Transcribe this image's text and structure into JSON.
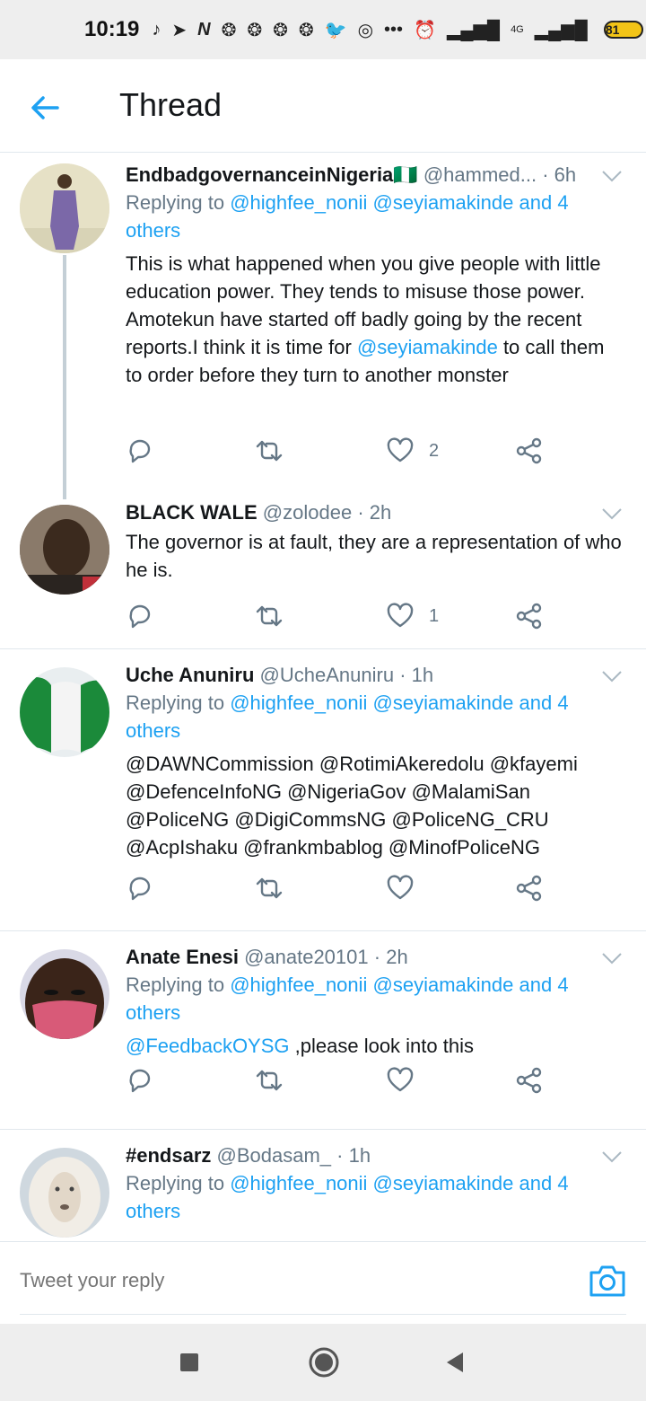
{
  "status_bar": {
    "time": "10:19",
    "icons": [
      "tiktok-icon",
      "telegram-icon",
      "nairaland-icon",
      "app-icon",
      "app-icon",
      "app-icon",
      "app-icon",
      "twitter-icon",
      "instagram-icon",
      "more-icon",
      "alarm-off-icon",
      "signal-icon",
      "4g-signal-icon"
    ],
    "network": "4G",
    "battery": "81"
  },
  "header": {
    "title": "Thread"
  },
  "tweets": [
    {
      "name": "EndbadgovernanceinNigeria",
      "flag": "🇳🇬",
      "handle": "@hammed...",
      "time": "· 6h",
      "replying_prefix": "Replying to",
      "replying_to": "@highfee_nonii @seyiamakinde and 4",
      "replying_suffix": "others",
      "body_part1": "This is what happened when you give people with little education power. They tends to misuse those power. Amotekun have started off badly going by the recent reports.I think it is time for ",
      "body_mention": "@seyiamakinde",
      "body_part2": " to call them to order before they turn to another monster",
      "likes": "2"
    },
    {
      "name": "BLACK WALE",
      "handle": "@zolodee",
      "time": "· 2h",
      "body": "The governor is at fault, they are a representation of who he is.",
      "likes": "1"
    },
    {
      "name": "Uche Anuniru",
      "handle": "@UcheAnuniru",
      "time": "· 1h",
      "replying_prefix": "Replying to",
      "replying_to": "@highfee_nonii @seyiamakinde and 4",
      "replying_suffix": "others",
      "body": "@DAWNCommission @RotimiAkeredolu @kfayemi @DefenceInfoNG @NigeriaGov @MalamiSan @PoliceNG @DigiCommsNG @PoliceNG_CRU @AcpIshaku @frankmbablog @MinofPoliceNG"
    },
    {
      "name": "Anate Enesi",
      "handle": "@anate20101",
      "time": "· 2h",
      "replying_prefix": "Replying to",
      "replying_to": "@highfee_nonii @seyiamakinde and 4",
      "replying_suffix": "others",
      "body_mention": "@FeedbackOYSG",
      "body_text": " ,please look into this"
    },
    {
      "name": "#endsarz",
      "handle": "@Bodasam_",
      "time": "· 1h",
      "replying_prefix": "Replying to",
      "replying_to": "@highfee_nonii @seyiamakinde and 4",
      "replying_suffix": "others"
    }
  ],
  "reply_bar": {
    "placeholder": "Tweet your reply"
  },
  "colors": {
    "accent": "#1da1f2",
    "text": "#14171a",
    "muted": "#657786",
    "divider": "#e1e8ed"
  }
}
